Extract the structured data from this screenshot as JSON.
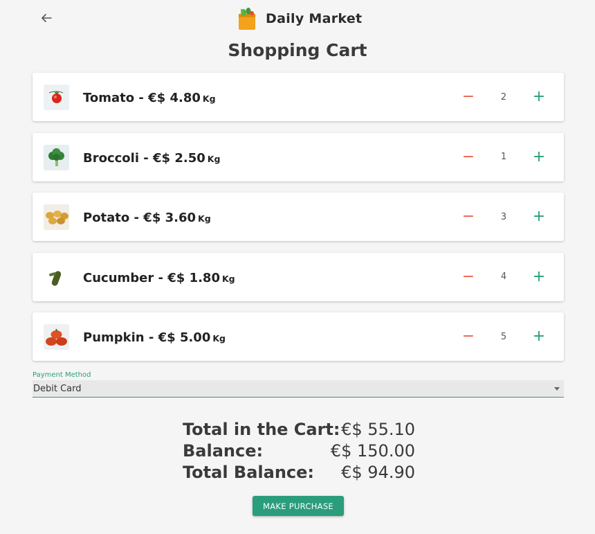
{
  "header": {
    "back_icon": "arrow-left-icon",
    "logo_icon": "shopping-bag-icon",
    "logo_text": "Daily Market"
  },
  "page": {
    "title": "Shopping Cart"
  },
  "cart": {
    "items": [
      {
        "name": "Tomato",
        "price": "€$ 4.80",
        "unit": "Kg",
        "quantity": "2",
        "thumb_icon": "tomato-icon"
      },
      {
        "name": "Broccoli",
        "price": "€$ 2.50",
        "unit": "Kg",
        "quantity": "1",
        "thumb_icon": "broccoli-icon"
      },
      {
        "name": "Potato",
        "price": "€$ 3.60",
        "unit": "Kg",
        "quantity": "3",
        "thumb_icon": "potato-icon"
      },
      {
        "name": "Cucumber",
        "price": "€$ 1.80",
        "unit": "Kg",
        "quantity": "4",
        "thumb_icon": "cucumber-icon"
      },
      {
        "name": "Pumpkin",
        "price": "€$ 5.00",
        "unit": "Kg",
        "quantity": "5",
        "thumb_icon": "pumpkin-icon"
      }
    ],
    "separator": " - ",
    "minus_label": "−",
    "plus_label": "+"
  },
  "payment": {
    "label": "Payment Method",
    "selected": "Debit Card"
  },
  "totals": {
    "cart_label": "Total in the Cart:",
    "cart_value": "€$ 55.10",
    "balance_label": "Balance:",
    "balance_value": "€$ 150.00",
    "total_balance_label": "Total Balance:",
    "total_balance_value": "€$ 94.90"
  },
  "actions": {
    "purchase_label": "MAKE PURCHASE"
  },
  "colors": {
    "accent": "#2a9d7c",
    "minus": "#e8604c",
    "background": "#f5f5f5"
  }
}
